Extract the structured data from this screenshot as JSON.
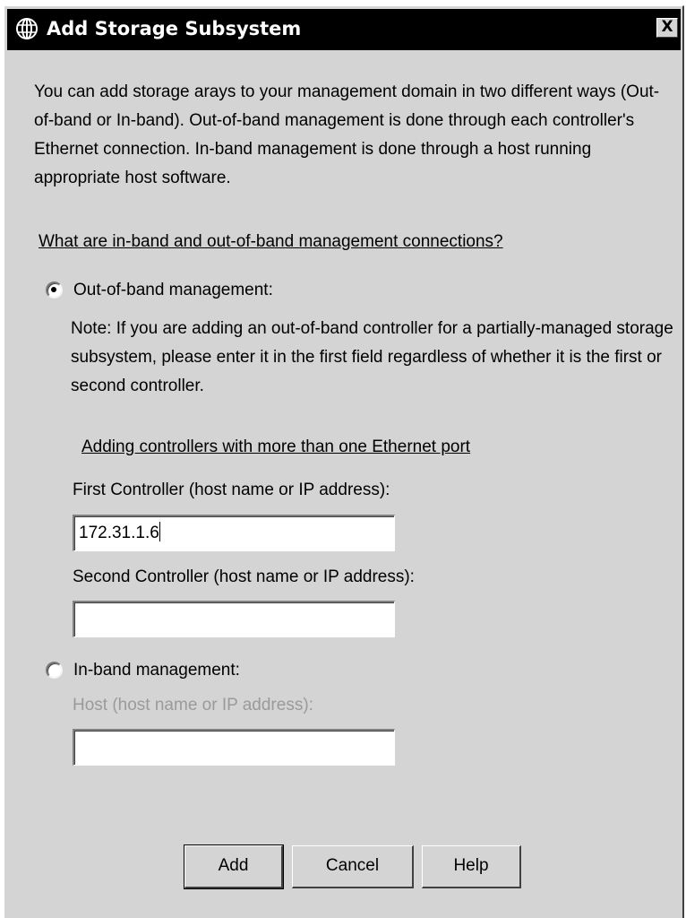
{
  "window": {
    "title": "Add Storage Subsystem",
    "close_label": "X",
    "title_icon": "globe-icon"
  },
  "intro_text": "You can add storage arays to your management domain in two different ways (Out-of-band or In-band). Out-of-band management is done through each controller's Ethernet connection. In-band management is done through a host running appropriate host software.",
  "links": {
    "connections_help": "What are in-band and out-of-band management connections?",
    "multi_port_help": "Adding controllers with more than one Ethernet port"
  },
  "out_of_band": {
    "label": "Out-of-band management:",
    "selected": true,
    "note": "Note: If you are adding an out-of-band controller for a partially-managed storage subsystem, please enter it in the first field regardless of whether it is the first or second controller.",
    "first_controller": {
      "label": "First Controller (host name or IP address):",
      "value": "172.31.1.6"
    },
    "second_controller": {
      "label": "Second Controller (host name or IP address):",
      "value": ""
    }
  },
  "in_band": {
    "label": "In-band management:",
    "selected": false,
    "host": {
      "label": "Host (host name or IP address):",
      "value": ""
    }
  },
  "buttons": {
    "add": "Add",
    "cancel": "Cancel",
    "help": "Help"
  }
}
